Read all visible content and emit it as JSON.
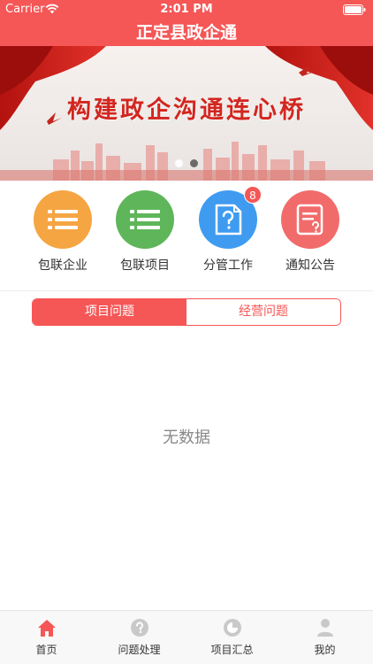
{
  "status_bar": {
    "carrier": "Carrier",
    "time": "2:01 PM"
  },
  "nav": {
    "title": "正定县政企通"
  },
  "banner": {
    "slogan": "构建政企沟通连心桥",
    "slide_count": 2,
    "active_slide": 1
  },
  "menu": {
    "items": [
      {
        "label": "包联企业",
        "icon": "list-icon",
        "color": "#f5a542"
      },
      {
        "label": "包联项目",
        "icon": "list-icon",
        "color": "#5fb65a"
      },
      {
        "label": "分管工作",
        "icon": "question-document-icon",
        "color": "#3f9bf0",
        "badge": "8"
      },
      {
        "label": "通知公告",
        "icon": "notice-document-icon",
        "color": "#f26b6b"
      }
    ]
  },
  "segment": {
    "tabs": [
      "项目问题",
      "经营问题"
    ],
    "active": 0
  },
  "empty_text": "无数据",
  "tabbar": {
    "items": [
      {
        "label": "首页",
        "icon": "home-icon",
        "active": true
      },
      {
        "label": "问题处理",
        "icon": "question-circle-icon",
        "active": false
      },
      {
        "label": "项目汇总",
        "icon": "chart-circle-icon",
        "active": false
      },
      {
        "label": "我的",
        "icon": "person-icon",
        "active": false
      }
    ]
  },
  "colors": {
    "primary": "#f55656",
    "tab_inactive": "#c9c9c9",
    "text": "#333333"
  }
}
